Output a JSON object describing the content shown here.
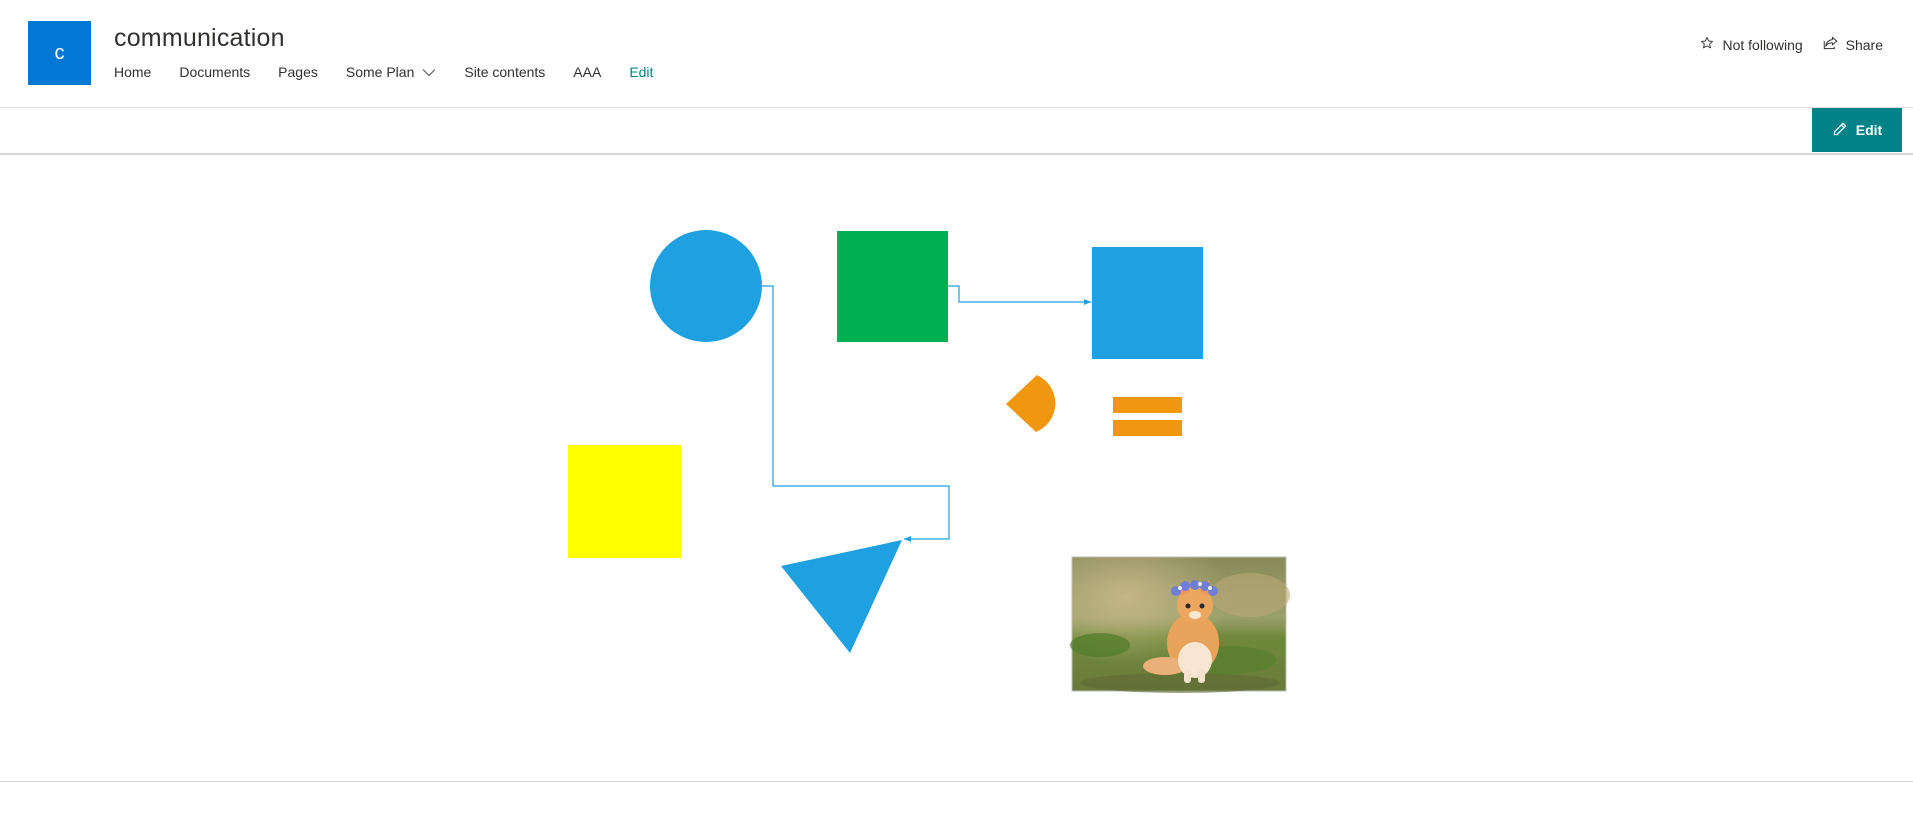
{
  "site": {
    "logo_letter": "c",
    "title": "communication"
  },
  "nav": {
    "items": [
      {
        "label": "Home"
      },
      {
        "label": "Documents"
      },
      {
        "label": "Pages"
      },
      {
        "label": "Some Plan",
        "has_dropdown": true
      },
      {
        "label": "Site contents"
      },
      {
        "label": "AAA"
      }
    ],
    "edit_label": "Edit"
  },
  "actions": {
    "follow_label": "Not following",
    "follow_icon": "star-outline-icon",
    "share_label": "Share",
    "share_icon": "share-icon"
  },
  "command_bar": {
    "edit_button_label": "Edit",
    "edit_icon": "pencil-icon"
  },
  "canvas": {
    "shapes": [
      {
        "name": "blue-circle",
        "kind": "circle",
        "color": "#1ea0e1"
      },
      {
        "name": "green-square",
        "kind": "rect",
        "color": "#00b050"
      },
      {
        "name": "blue-square",
        "kind": "rect",
        "color": "#1ea0e1"
      },
      {
        "name": "orange-pie-shape",
        "kind": "pie",
        "color": "#f0960f"
      },
      {
        "name": "orange-equal-sign",
        "kind": "equals",
        "color": "#f0960f"
      },
      {
        "name": "yellow-square",
        "kind": "rect",
        "color": "#ffff00"
      },
      {
        "name": "blue-triangle",
        "kind": "triangle",
        "color": "#1ea0e1"
      },
      {
        "name": "kitten-image",
        "kind": "image"
      }
    ],
    "connectors": [
      {
        "name": "connector-green-to-blue",
        "color": "#1ea0e1"
      },
      {
        "name": "connector-circle-to-triangle",
        "color": "#1ea0e1"
      }
    ]
  },
  "colors": {
    "brand": "#0078d4",
    "accent_teal": "#038387",
    "text": "#323130",
    "divider": "#d6d6d6"
  }
}
